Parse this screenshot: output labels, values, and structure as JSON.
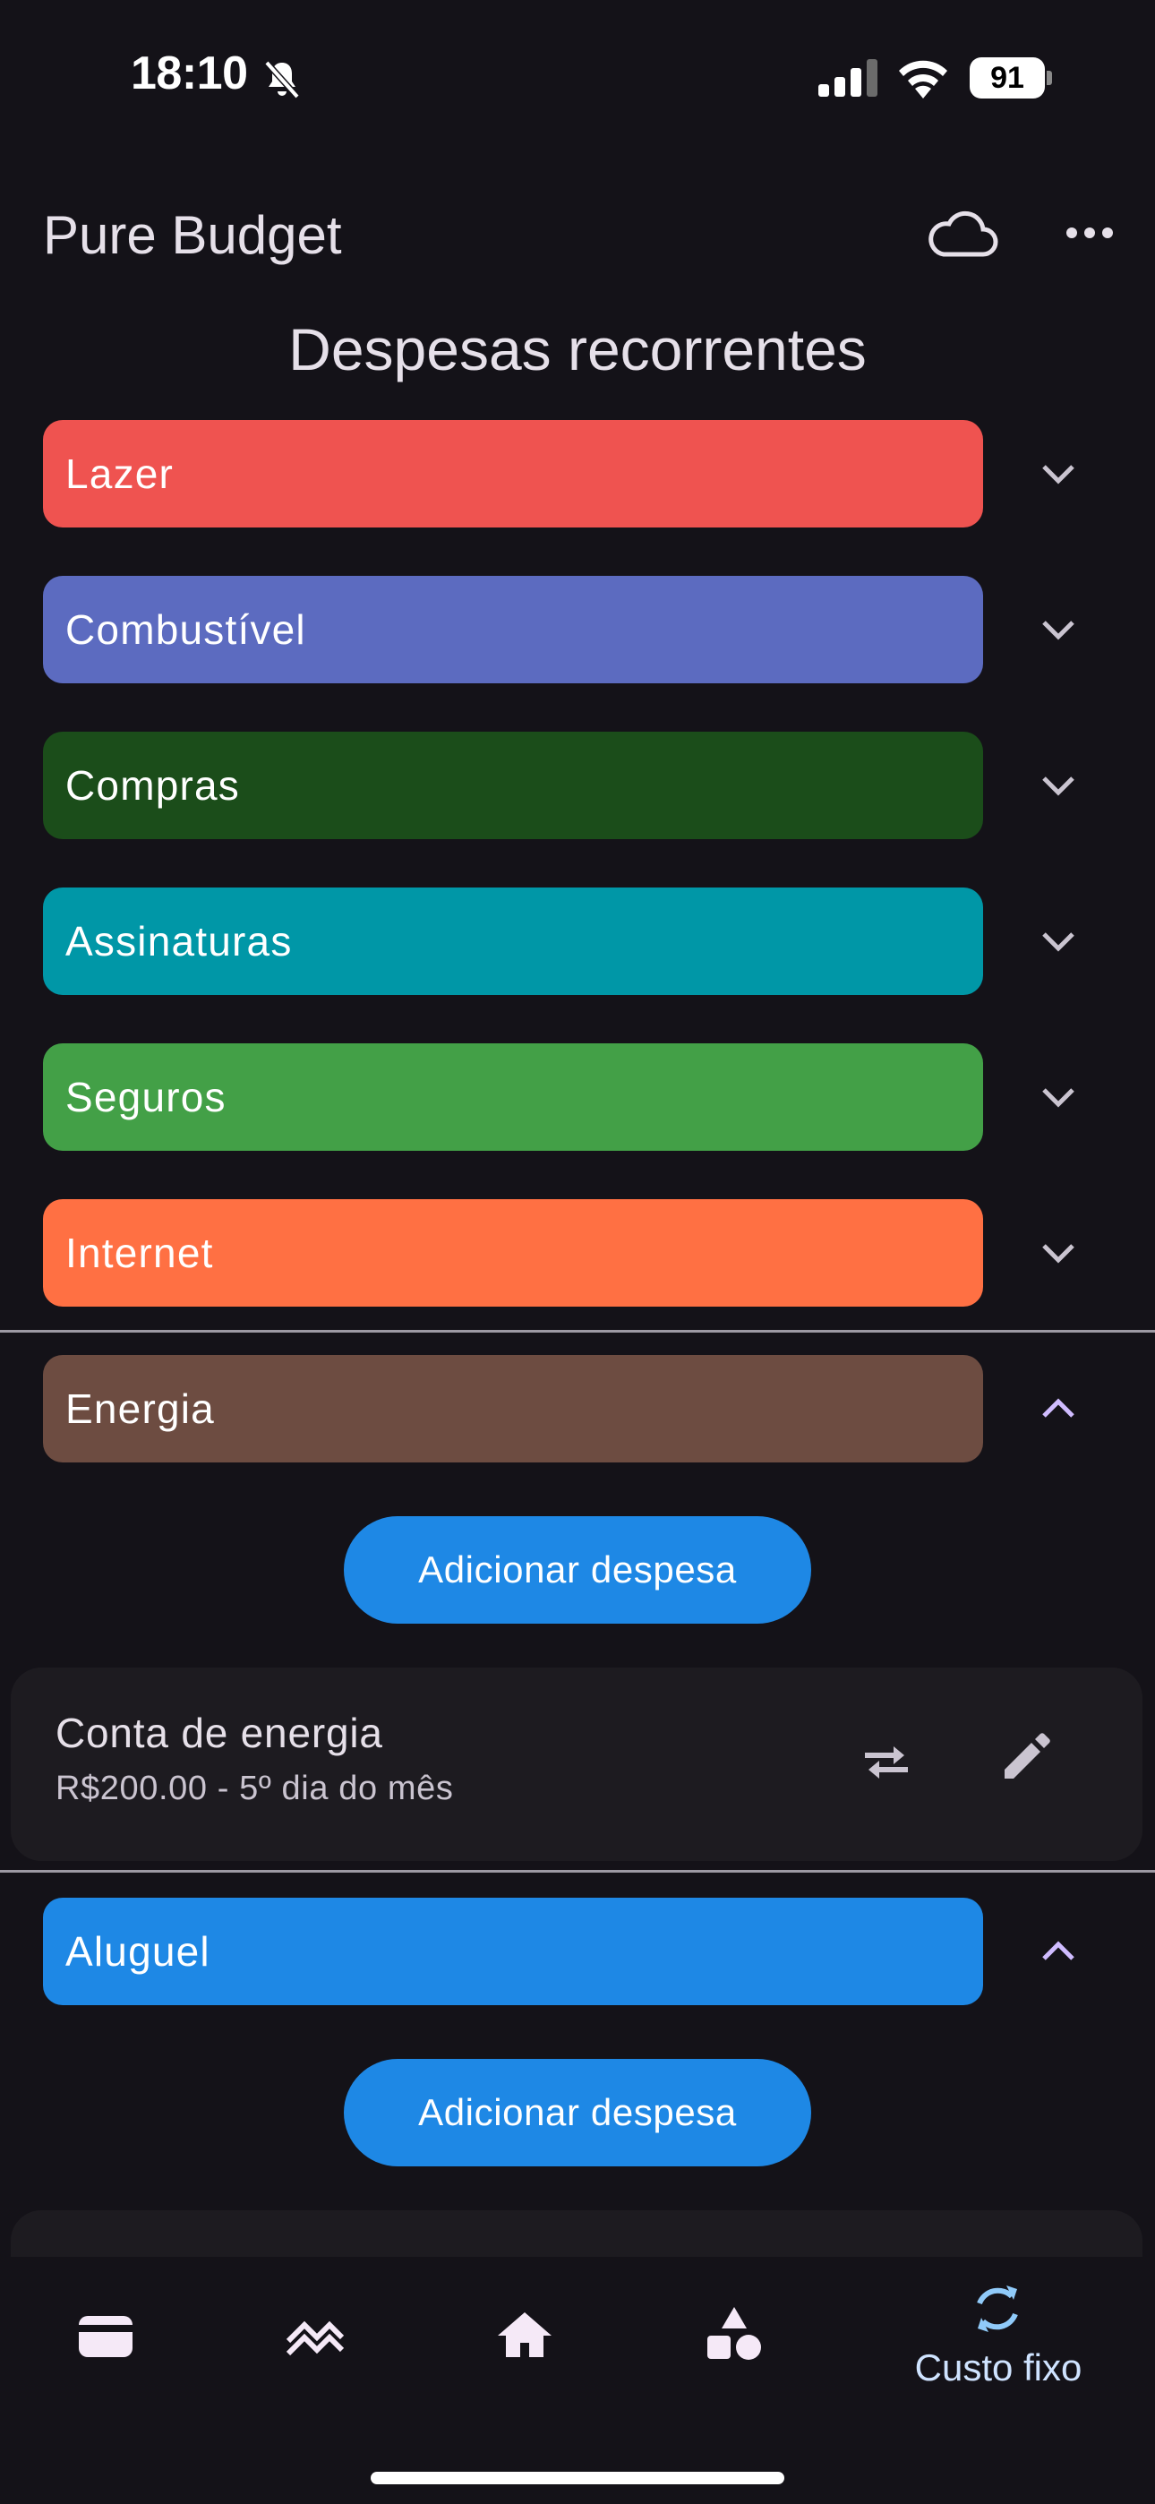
{
  "status_bar": {
    "time": "18:10",
    "battery": "91"
  },
  "header": {
    "app_title": "Pure Budget",
    "cloud_icon": "cloud-icon",
    "more_icon": "more-horiz-icon"
  },
  "page_title": "Despesas recorrentes",
  "categories": [
    {
      "label": "Lazer",
      "color": "#EF5350",
      "expanded": false
    },
    {
      "label": "Combustível",
      "color": "#5C6BC0",
      "expanded": false
    },
    {
      "label": "Compras",
      "color": "#1B4D1A",
      "expanded": false
    },
    {
      "label": "Assinaturas",
      "color": "#0097A7",
      "expanded": false
    },
    {
      "label": "Seguros",
      "color": "#43A047",
      "expanded": false
    },
    {
      "label": "Internet",
      "color": "#FF7043",
      "expanded": false
    },
    {
      "label": "Energia",
      "color": "#6D4C41",
      "expanded": true
    },
    {
      "label": "Aluguel",
      "color": "#1E88E5",
      "expanded": true
    }
  ],
  "add_expense_label": "Adicionar despesa",
  "expenses": [
    {
      "title": "Conta de energia",
      "subtitle": "R$200.00 - 5º dia do mês"
    }
  ],
  "bottom_nav": {
    "items": [
      {
        "icon": "wallet-icon"
      },
      {
        "icon": "trending-icon"
      },
      {
        "icon": "home-icon"
      },
      {
        "icon": "category-shapes-icon"
      },
      {
        "icon": "sync-icon",
        "label": "Custo fixo",
        "active": true
      }
    ]
  },
  "accent_color": "#1E88E5"
}
